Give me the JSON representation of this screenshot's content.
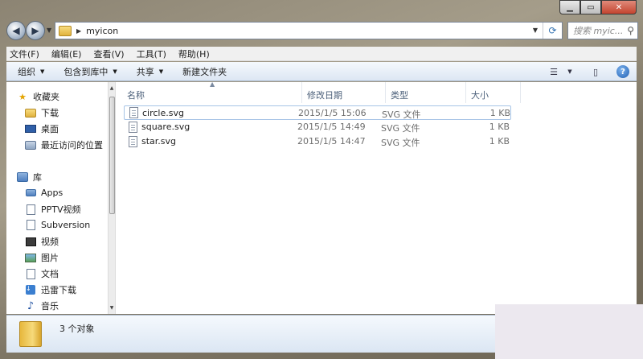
{
  "window": {
    "min_label": "▁",
    "max_label": "▭",
    "close_label": "✕"
  },
  "address": {
    "path": "myicon",
    "search_placeholder": "搜索 myic..."
  },
  "menu": [
    "文件(F)",
    "编辑(E)",
    "查看(V)",
    "工具(T)",
    "帮助(H)"
  ],
  "toolbar": {
    "organize": "组织",
    "include": "包含到库中",
    "share": "共享",
    "new_folder": "新建文件夹"
  },
  "nav": {
    "favorites": "收藏夹",
    "favorites_items": [
      "下载",
      "桌面",
      "最近访问的位置"
    ],
    "libraries": "库",
    "library_items": [
      "Apps",
      "PPTV视频",
      "Subversion",
      "视频",
      "图片",
      "文档",
      "迅雷下载",
      "音乐"
    ]
  },
  "columns": {
    "name": "名称",
    "date": "修改日期",
    "type": "类型",
    "size": "大小"
  },
  "files": [
    {
      "name": "circle.svg",
      "date": "2015/1/5 15:06",
      "type": "SVG 文件",
      "size": "1 KB"
    },
    {
      "name": "square.svg",
      "date": "2015/1/5 14:49",
      "type": "SVG 文件",
      "size": "1 KB"
    },
    {
      "name": "star.svg",
      "date": "2015/1/5 14:47",
      "type": "SVG 文件",
      "size": "1 KB"
    }
  ],
  "status": {
    "count": "3 个对象"
  }
}
